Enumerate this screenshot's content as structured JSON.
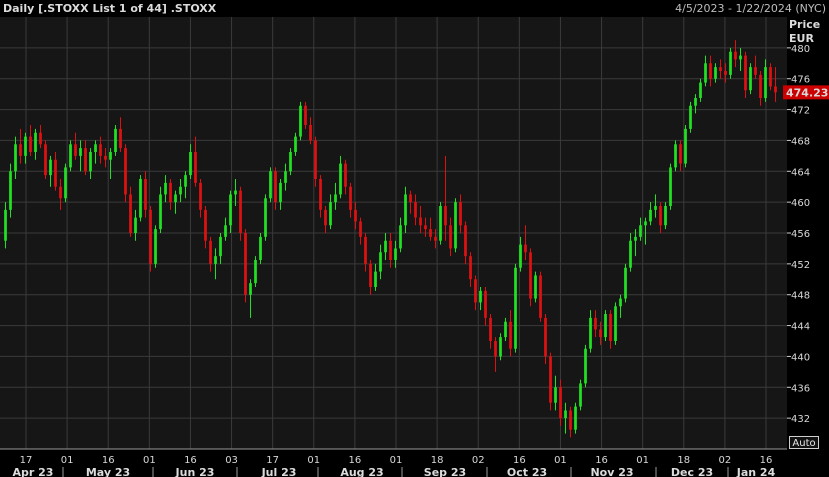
{
  "header": {
    "title": "Daily [.STOXX List 1 of 44] .STOXX",
    "date_range": "4/5/2023 - 1/22/2024 (NYC)"
  },
  "price_axis": {
    "label_line1": "Price",
    "label_line2": "EUR",
    "last_price": "474.23",
    "last_price_value": 474.23,
    "last_price_color": "#cc0000"
  },
  "auto_button": {
    "label": "Auto"
  },
  "colors": {
    "background": "#000000",
    "plot_background": "#161616",
    "grid": "#3a3a3a",
    "up": "#22e022",
    "down": "#dd1111"
  },
  "chart_data": {
    "type": "candlestick",
    "ylim": [
      428,
      484
    ],
    "y_ticks": [
      432,
      436,
      440,
      444,
      448,
      452,
      456,
      460,
      464,
      468,
      472,
      476,
      480
    ],
    "x_ticks": [
      "17",
      "01",
      "16",
      "01",
      "16",
      "03",
      "17",
      "01",
      "16",
      "01",
      "18",
      "02",
      "16",
      "01",
      "16",
      "01",
      "18",
      "02",
      "16"
    ],
    "month_labels": [
      "Apr 23",
      "May 23",
      "Jun 23",
      "Jul 23",
      "Aug 23",
      "Sep 23",
      "Oct 23",
      "Nov 23",
      "Dec 23",
      "Jan 24"
    ],
    "series": [
      {
        "values": [
          [
            455.0,
            460.0,
            454.0,
            459.0
          ],
          [
            459.0,
            465.0,
            458.0,
            464.0
          ],
          [
            464.0,
            468.5,
            463.0,
            467.5
          ],
          [
            467.5,
            469.5,
            465.0,
            466.0
          ],
          [
            466.0,
            469.0,
            465.0,
            468.5
          ],
          [
            468.5,
            470.0,
            466.0,
            466.5
          ],
          [
            466.5,
            469.5,
            465.5,
            469.0
          ],
          [
            469.0,
            470.0,
            467.0,
            467.5
          ],
          [
            467.5,
            468.0,
            463.0,
            463.5
          ],
          [
            463.5,
            466.0,
            462.0,
            465.5
          ],
          [
            465.5,
            466.5,
            461.5,
            462.0
          ],
          [
            462.0,
            463.0,
            459.0,
            460.5
          ],
          [
            460.5,
            465.0,
            460.0,
            464.5
          ],
          [
            464.5,
            468.0,
            464.0,
            467.5
          ],
          [
            467.5,
            469.0,
            465.5,
            466.0
          ],
          [
            466.0,
            468.0,
            464.0,
            467.0
          ],
          [
            467.0,
            468.0,
            463.5,
            464.0
          ],
          [
            464.0,
            467.0,
            463.0,
            466.5
          ],
          [
            466.5,
            468.0,
            465.0,
            467.5
          ],
          [
            467.5,
            468.5,
            465.0,
            466.0
          ],
          [
            466.0,
            467.0,
            464.5,
            465.5
          ],
          [
            465.5,
            467.0,
            463.0,
            466.5
          ],
          [
            466.5,
            470.0,
            466.0,
            469.5
          ],
          [
            469.5,
            471.0,
            466.5,
            467.0
          ],
          [
            467.0,
            467.5,
            460.0,
            461.0
          ],
          [
            461.0,
            462.0,
            455.5,
            456.0
          ],
          [
            456.0,
            459.0,
            455.0,
            458.0
          ],
          [
            458.0,
            463.5,
            457.5,
            463.0
          ],
          [
            463.0,
            464.0,
            458.0,
            459.0
          ],
          [
            459.0,
            459.5,
            451.0,
            452.0
          ],
          [
            452.0,
            457.0,
            451.5,
            456.5
          ],
          [
            456.5,
            462.0,
            456.0,
            461.0
          ],
          [
            461.0,
            463.5,
            460.0,
            462.5
          ],
          [
            462.5,
            463.0,
            459.0,
            460.0
          ],
          [
            460.0,
            461.5,
            458.5,
            461.0
          ],
          [
            461.0,
            463.0,
            460.0,
            462.0
          ],
          [
            462.0,
            464.0,
            460.5,
            463.5
          ],
          [
            463.5,
            467.5,
            463.0,
            466.5
          ],
          [
            466.5,
            468.5,
            462.0,
            462.5
          ],
          [
            462.5,
            463.0,
            458.0,
            459.0
          ],
          [
            459.0,
            459.5,
            454.0,
            455.0
          ],
          [
            455.0,
            455.5,
            451.0,
            452.0
          ],
          [
            452.0,
            454.0,
            450.0,
            453.0
          ],
          [
            453.0,
            456.0,
            452.0,
            455.5
          ],
          [
            455.5,
            458.0,
            455.0,
            457.0
          ],
          [
            457.0,
            461.5,
            456.0,
            461.0
          ],
          [
            461.0,
            463.0,
            459.5,
            461.5
          ],
          [
            461.5,
            462.0,
            455.0,
            456.0
          ],
          [
            456.0,
            456.5,
            447.0,
            448.0
          ],
          [
            448.0,
            450.0,
            445.0,
            449.5
          ],
          [
            449.5,
            453.0,
            449.0,
            452.5
          ],
          [
            452.5,
            456.0,
            452.0,
            455.5
          ],
          [
            455.5,
            461.0,
            455.0,
            460.5
          ],
          [
            460.5,
            464.5,
            460.0,
            464.0
          ],
          [
            464.0,
            464.5,
            459.0,
            460.0
          ],
          [
            460.0,
            463.0,
            459.0,
            462.5
          ],
          [
            462.5,
            465.0,
            461.5,
            464.0
          ],
          [
            464.0,
            467.0,
            463.5,
            466.5
          ],
          [
            466.5,
            469.0,
            466.0,
            468.5
          ],
          [
            468.5,
            473.0,
            468.0,
            472.5
          ],
          [
            472.5,
            473.0,
            469.5,
            470.0
          ],
          [
            470.0,
            471.0,
            467.5,
            468.0
          ],
          [
            468.0,
            468.5,
            462.0,
            463.0
          ],
          [
            463.0,
            463.5,
            458.0,
            459.0
          ],
          [
            459.0,
            459.5,
            456.0,
            457.0
          ],
          [
            457.0,
            461.0,
            456.5,
            460.0
          ],
          [
            460.0,
            462.5,
            459.0,
            461.0
          ],
          [
            461.0,
            466.0,
            460.5,
            465.0
          ],
          [
            465.0,
            465.5,
            461.0,
            462.0
          ],
          [
            462.0,
            462.5,
            458.0,
            459.0
          ],
          [
            459.0,
            460.0,
            456.5,
            457.5
          ],
          [
            457.5,
            458.0,
            454.5,
            455.5
          ],
          [
            455.5,
            456.0,
            451.0,
            452.0
          ],
          [
            452.0,
            452.5,
            448.0,
            449.0
          ],
          [
            449.0,
            452.0,
            448.5,
            451.0
          ],
          [
            451.0,
            454.5,
            450.0,
            453.5
          ],
          [
            453.5,
            456.0,
            452.5,
            455.0
          ],
          [
            455.0,
            456.0,
            451.5,
            452.5
          ],
          [
            452.5,
            455.0,
            451.5,
            454.0
          ],
          [
            454.0,
            458.0,
            453.5,
            457.0
          ],
          [
            457.0,
            462.0,
            456.0,
            461.0
          ],
          [
            461.0,
            461.5,
            458.5,
            460.0
          ],
          [
            460.0,
            461.0,
            457.0,
            458.0
          ],
          [
            458.0,
            459.5,
            456.0,
            457.0
          ],
          [
            457.0,
            458.0,
            455.5,
            456.5
          ],
          [
            456.5,
            458.0,
            455.0,
            455.5
          ],
          [
            455.5,
            456.5,
            454.0,
            455.0
          ],
          [
            455.0,
            460.0,
            454.5,
            459.5
          ],
          [
            459.5,
            466.0,
            455.0,
            457.0
          ],
          [
            457.0,
            458.0,
            453.0,
            454.0
          ],
          [
            454.0,
            460.5,
            453.5,
            460.0
          ],
          [
            460.0,
            461.0,
            456.0,
            457.0
          ],
          [
            457.0,
            457.5,
            452.0,
            453.0
          ],
          [
            453.0,
            453.5,
            449.0,
            450.0
          ],
          [
            450.0,
            450.5,
            446.0,
            447.0
          ],
          [
            447.0,
            449.0,
            446.0,
            448.5
          ],
          [
            448.5,
            449.0,
            444.0,
            445.0
          ],
          [
            445.0,
            445.5,
            441.0,
            442.0
          ],
          [
            442.0,
            442.5,
            438.0,
            440.0
          ],
          [
            440.0,
            443.0,
            439.5,
            442.5
          ],
          [
            442.5,
            445.0,
            442.0,
            444.5
          ],
          [
            444.5,
            446.0,
            440.0,
            441.0
          ],
          [
            441.0,
            452.0,
            440.5,
            451.5
          ],
          [
            451.5,
            455.5,
            451.0,
            454.5
          ],
          [
            454.5,
            457.0,
            452.5,
            453.5
          ],
          [
            453.5,
            454.0,
            446.5,
            447.5
          ],
          [
            447.5,
            451.0,
            447.0,
            450.5
          ],
          [
            450.5,
            451.0,
            444.5,
            445.0
          ],
          [
            445.0,
            445.5,
            439.0,
            440.0
          ],
          [
            440.0,
            440.5,
            433.0,
            434.0
          ],
          [
            434.0,
            437.5,
            433.0,
            436.0
          ],
          [
            436.0,
            437.0,
            431.0,
            432.0
          ],
          [
            432.0,
            434.0,
            430.0,
            433.0
          ],
          [
            433.0,
            433.5,
            429.5,
            430.5
          ],
          [
            430.5,
            434.0,
            430.0,
            433.5
          ],
          [
            433.5,
            437.0,
            433.0,
            436.5
          ],
          [
            436.5,
            441.5,
            436.0,
            441.0
          ],
          [
            441.0,
            446.0,
            440.5,
            445.0
          ],
          [
            445.0,
            446.0,
            442.5,
            443.5
          ],
          [
            443.5,
            444.5,
            441.5,
            442.5
          ],
          [
            442.5,
            446.0,
            442.0,
            445.5
          ],
          [
            445.5,
            446.0,
            441.0,
            442.0
          ],
          [
            442.0,
            447.0,
            441.5,
            446.5
          ],
          [
            446.5,
            448.0,
            445.0,
            447.5
          ],
          [
            447.5,
            452.0,
            447.0,
            451.5
          ],
          [
            451.5,
            456.0,
            451.0,
            455.0
          ],
          [
            455.0,
            456.5,
            453.0,
            455.5
          ],
          [
            455.5,
            458.0,
            455.0,
            457.0
          ],
          [
            457.0,
            458.0,
            454.5,
            457.5
          ],
          [
            457.5,
            460.0,
            457.0,
            459.0
          ],
          [
            459.0,
            461.0,
            458.0,
            459.5
          ],
          [
            459.5,
            460.0,
            456.0,
            457.0
          ],
          [
            457.0,
            460.0,
            456.5,
            459.5
          ],
          [
            459.5,
            465.0,
            459.0,
            464.5
          ],
          [
            464.5,
            468.0,
            464.0,
            467.5
          ],
          [
            467.5,
            468.0,
            464.0,
            465.0
          ],
          [
            465.0,
            470.0,
            464.5,
            469.5
          ],
          [
            469.5,
            473.0,
            469.0,
            472.5
          ],
          [
            472.5,
            474.0,
            471.5,
            473.5
          ],
          [
            473.5,
            476.0,
            473.0,
            475.5
          ],
          [
            475.5,
            479.0,
            475.0,
            478.0
          ],
          [
            478.0,
            479.0,
            475.0,
            476.0
          ],
          [
            476.0,
            478.0,
            475.5,
            477.5
          ],
          [
            477.5,
            478.5,
            476.0,
            477.0
          ],
          [
            477.0,
            478.0,
            475.5,
            476.5
          ],
          [
            476.5,
            480.0,
            476.0,
            479.5
          ],
          [
            479.5,
            481.0,
            477.5,
            478.5
          ],
          [
            478.5,
            480.0,
            477.0,
            479.0
          ],
          [
            479.0,
            479.5,
            473.5,
            474.5
          ],
          [
            474.5,
            478.0,
            474.0,
            477.5
          ],
          [
            477.5,
            479.0,
            476.0,
            476.5
          ],
          [
            476.5,
            477.0,
            472.5,
            473.5
          ],
          [
            473.5,
            478.5,
            473.0,
            477.5
          ],
          [
            477.5,
            478.0,
            474.5,
            475.0
          ],
          [
            475.0,
            477.5,
            473.0,
            474.23
          ]
        ]
      }
    ]
  }
}
